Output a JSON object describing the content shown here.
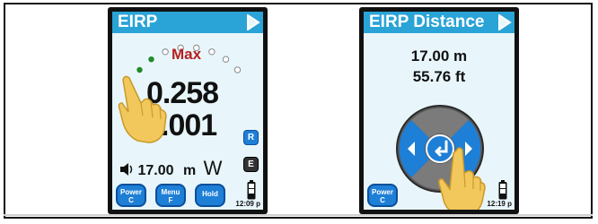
{
  "left_device": {
    "title": "EIRP",
    "max_label": "Max",
    "reading_primary": "0.258",
    "reading_secondary": ".001",
    "power_value": "17.00",
    "power_unit_prefix": "m",
    "power_unit": "W",
    "side_button_r": "R",
    "side_button_e": "E",
    "buttons": {
      "power": [
        "Power",
        "C"
      ],
      "menu": [
        "Menu",
        "F"
      ],
      "hold": "Hold"
    },
    "time": "12:09 p",
    "gauge": {
      "filled": 4,
      "total": 12
    }
  },
  "right_device": {
    "title": "EIRP Distance",
    "distance_m": "17.00 m",
    "distance_ft": "55.76 ft",
    "buttons": {
      "power": [
        "Power",
        "C"
      ]
    },
    "time": "12:19 p"
  },
  "colors": {
    "title_bar": "#2aa3d6",
    "screen_bg": "#e8f6fb",
    "max_red": "#b62020",
    "button_blue": "#1e7fd6",
    "gauge_green": "#1f8a2a"
  }
}
